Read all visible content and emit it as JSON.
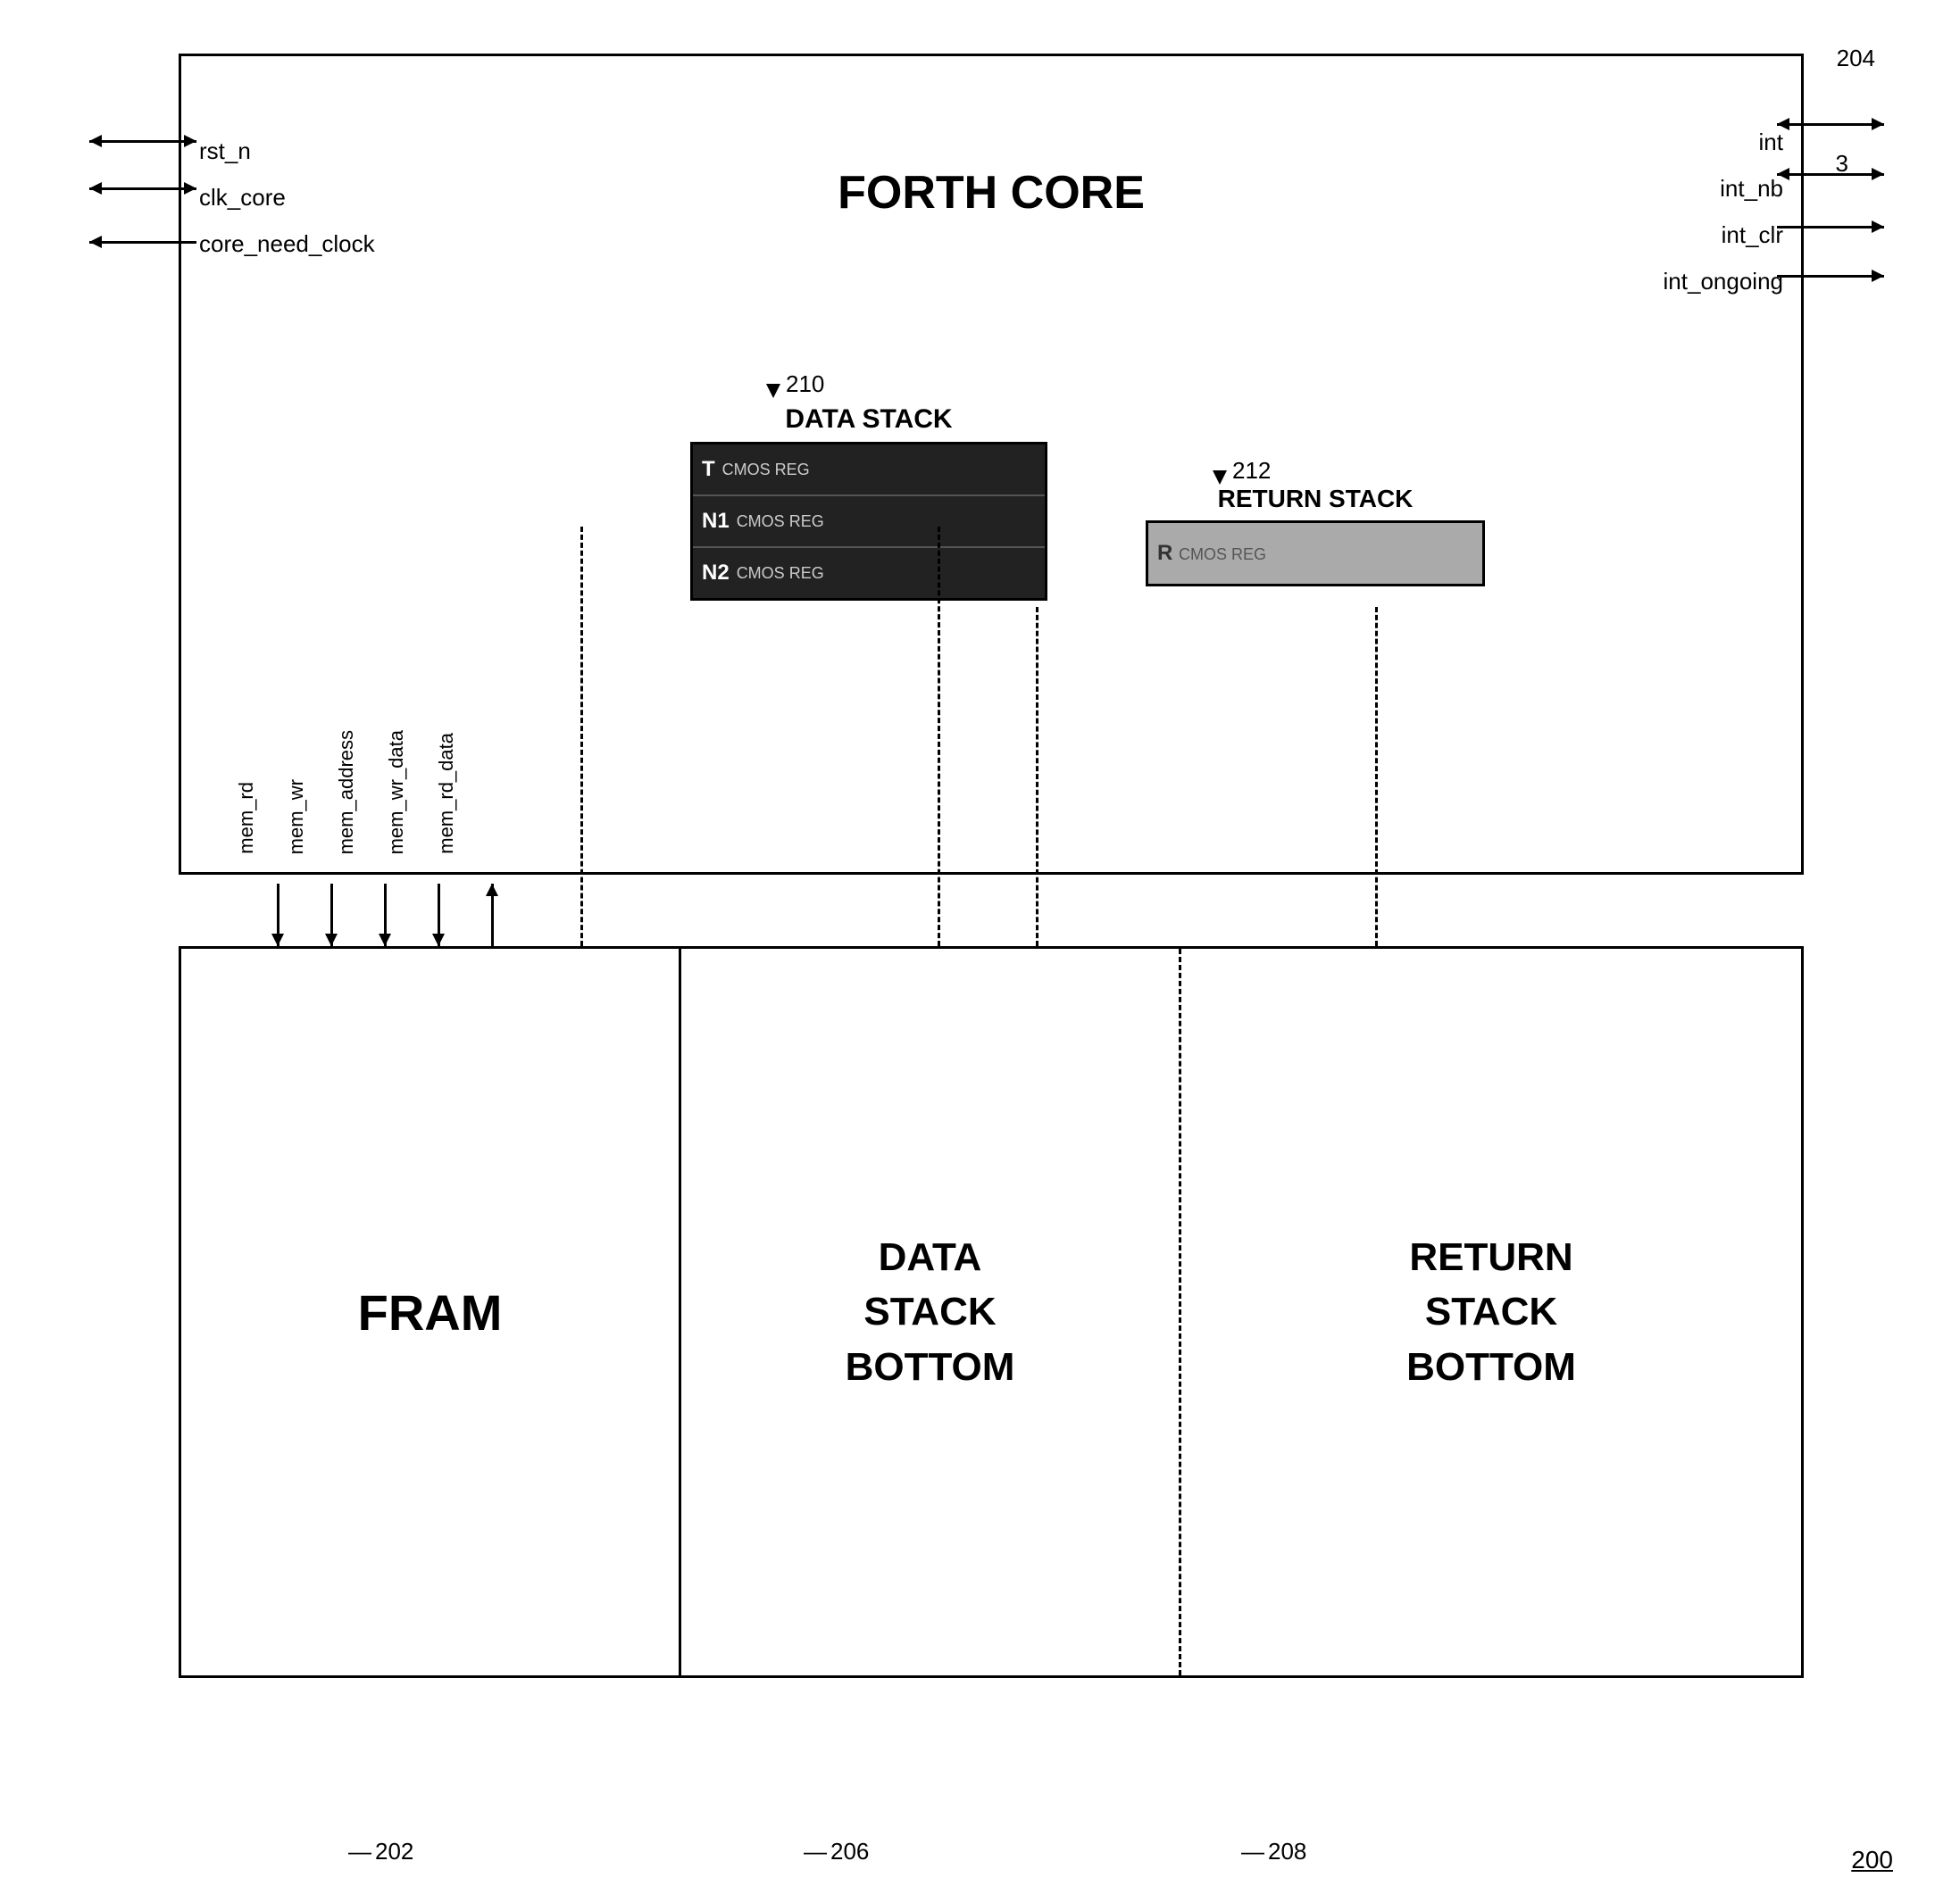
{
  "diagram": {
    "title": "FORTH CORE",
    "labels": {
      "ref_204": "204",
      "ref_200": "200",
      "ref_202": "202",
      "ref_206": "206",
      "ref_208": "208",
      "ref_210": "210",
      "ref_212": "212"
    },
    "left_signals": {
      "rst_n": "rst_n",
      "clk_core": "clk_core",
      "core_need_clock": "core_need_clock"
    },
    "right_signals": {
      "int": "int",
      "int_nb": "int_nb",
      "int_nb_number": "3",
      "int_clr": "int_clr",
      "int_ongoing": "int_ongoing"
    },
    "data_stack": {
      "title": "DATA STACK",
      "rows": [
        {
          "label": "T",
          "cmos": "CMOS REG"
        },
        {
          "label": "N1",
          "cmos": "CMOS REG"
        },
        {
          "label": "N2",
          "cmos": "CMOS REG"
        }
      ]
    },
    "return_stack": {
      "title": "RETURN STACK",
      "row": {
        "label": "R",
        "cmos": "CMOS REG"
      }
    },
    "bottom": {
      "fram": "FRAM",
      "data_stack_bottom": "DATA\nSTACK\nBOTTOM",
      "return_stack_bottom": "RETURN\nSTACK\nBOTTOM"
    },
    "vertical_signals": [
      "mem_rd",
      "mem_wr",
      "mem_address",
      "mem_wr_data",
      "mem_rd_data"
    ]
  }
}
